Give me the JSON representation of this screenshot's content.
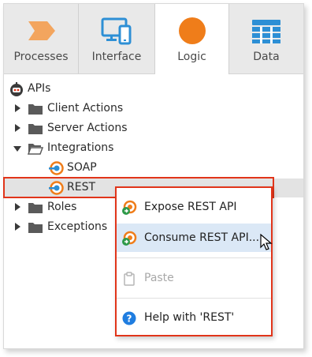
{
  "tabs": [
    {
      "label": "Processes",
      "icon": "processes-chevron-icon",
      "color": "#f3a55e",
      "active": false
    },
    {
      "label": "Interface",
      "icon": "devices-icon",
      "color": "#2d8fd5",
      "active": false
    },
    {
      "label": "Logic",
      "icon": "logic-circle-icon",
      "color": "#ef7d1a",
      "active": true
    },
    {
      "label": "Data",
      "icon": "data-grid-icon",
      "color": "#2d8fd5",
      "active": false
    }
  ],
  "tree": {
    "root_label": "APIs",
    "items": [
      {
        "label": "Client Actions"
      },
      {
        "label": "Server Actions"
      },
      {
        "label": "Integrations"
      },
      {
        "label": "SOAP"
      },
      {
        "label": "REST"
      },
      {
        "label": "Roles"
      },
      {
        "label": "Exceptions"
      }
    ]
  },
  "context_menu": {
    "items": [
      {
        "label": "Expose REST API",
        "icon": "expose-rest-icon"
      },
      {
        "label": "Consume REST API...",
        "icon": "consume-rest-icon"
      },
      {
        "label": "Paste",
        "icon": "paste-icon",
        "disabled": true
      },
      {
        "label": "Help with 'REST'",
        "icon": "help-icon"
      }
    ]
  },
  "colors": {
    "highlight_border": "#e1351a",
    "menu_hover": "#dbe8f6",
    "accent_orange": "#ef7d1a",
    "accent_blue": "#2d8fd5"
  }
}
